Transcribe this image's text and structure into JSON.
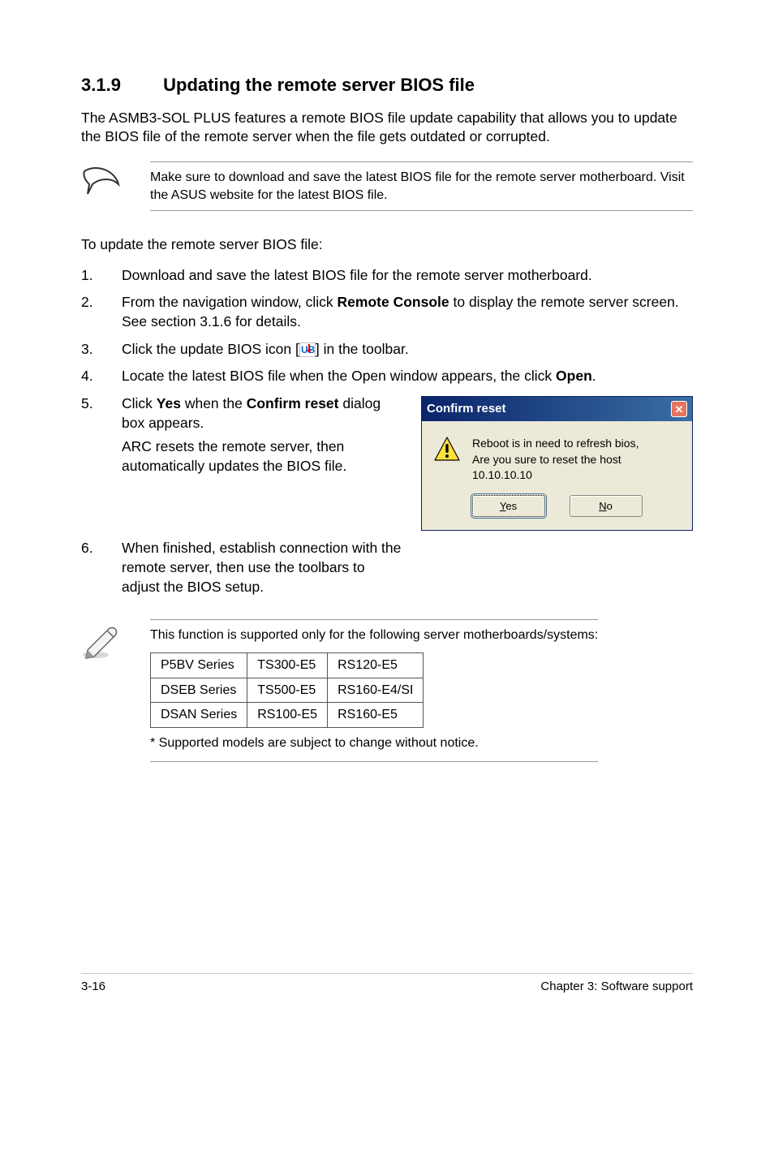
{
  "heading": {
    "number": "3.1.9",
    "title": "Updating the remote server BIOS file"
  },
  "intro": "The ASMB3-SOL PLUS features a remote BIOS file update capability that allows you to update the BIOS file of the remote server when the file gets outdated or corrupted.",
  "note1": "Make sure to download and save the latest BIOS file for the remote server motherboard. Visit the ASUS website for the latest BIOS file.",
  "stepsIntro": "To update the remote server BIOS file:",
  "steps": {
    "s1": "Download and save the latest BIOS file for the remote server motherboard.",
    "s2a": "From the navigation window, click ",
    "s2b": "Remote Console",
    "s2c": " to display the remote server screen. See section 3.1.6 for details.",
    "s3a": "Click the update BIOS icon [",
    "s3b": "] in the toolbar.",
    "s4a": "Locate the latest BIOS file when the Open window appears, the click ",
    "s4b": "Open",
    "s4c": ".",
    "s5a": "Click ",
    "s5b": "Yes",
    "s5c": " when the ",
    "s5d": "Confirm reset",
    "s5e": " dialog box appears.",
    "s5sub": "ARC resets the remote server, then automatically updates the BIOS file.",
    "s6": "When finished, establish connection with the remote server, then use the toolbars to adjust the BIOS setup."
  },
  "dialog": {
    "title": "Confirm reset",
    "msg1": "Reboot is in need to refresh bios,",
    "msg2": "Are you sure to reset the host",
    "msg3": "10.10.10.10",
    "yes": "Yes",
    "no": "No"
  },
  "supportIntro": "This function is supported only for the following server motherboards/systems:",
  "table": {
    "r1c1": "P5BV Series",
    "r1c2": "TS300-E5",
    "r1c3": "RS120-E5",
    "r2c1": "DSEB Series",
    "r2c2": "TS500-E5",
    "r2c3": "RS160-E4/SI",
    "r3c1": "DSAN Series",
    "r3c2": "RS100-E5",
    "r3c3": "RS160-E5"
  },
  "tableNote": "* Supported models are subject to change without notice.",
  "footer": {
    "left": "3-16",
    "right": "Chapter 3: Software support"
  }
}
